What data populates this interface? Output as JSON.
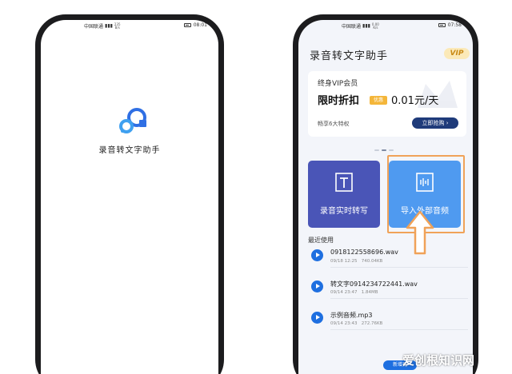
{
  "splash": {
    "status": {
      "carrier": "中国联通",
      "speed_value": "235",
      "speed_unit": "B/s",
      "time": "08:01"
    },
    "app_name": "录音转文字助手"
  },
  "main": {
    "status": {
      "carrier": "中国联通",
      "speed_value": "0.00",
      "speed_unit": "K/s",
      "time": "07:58"
    },
    "header": {
      "title": "录音转文字助手",
      "vip_badge": "VIP"
    },
    "vip_card": {
      "title": "终身VIP会员",
      "main": "限时折扣",
      "discount_tag": "优惠",
      "price": "0.01元/天",
      "note": "畅享6大特权",
      "buy_label": "立即抢购"
    },
    "tiles": {
      "record_label": "录音实时转写",
      "import_label": "导入外部音频"
    },
    "section_label": "最近使用",
    "files": [
      {
        "name": "0918122558696.wav",
        "date": "09/18 12:25",
        "size": "740.04KB"
      },
      {
        "name": "转文字0914234722441.wav",
        "date": "09/14 23:47",
        "size": "1.84MB"
      },
      {
        "name": "示例音频.mp3",
        "date": "09/14 23:43",
        "size": "272.76KB"
      }
    ],
    "new_button": "新增更"
  },
  "watermark": "爱创根知识网",
  "colors": {
    "record_tile": "#4a55b7",
    "import_tile": "#4f9af0",
    "highlight": "#f0a258",
    "play": "#1e6fe0",
    "vip_gold": "#f4b63a"
  }
}
